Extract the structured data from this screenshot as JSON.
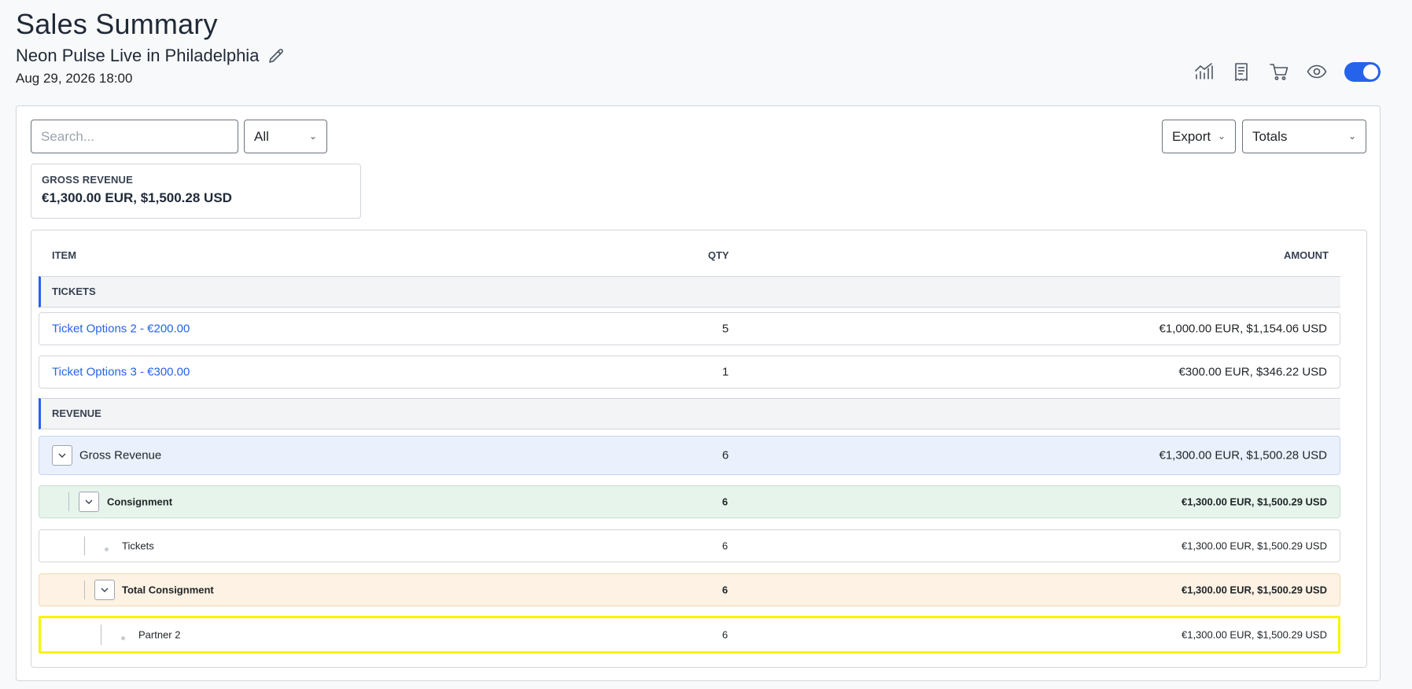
{
  "header": {
    "title": "Sales Summary",
    "event_name": "Neon Pulse Live in Philadelphia",
    "event_date": "Aug 29, 2026 18:00"
  },
  "toolbar": {
    "icons": [
      "analytics-chart-icon",
      "receipt-icon",
      "cart-icon",
      "eye-icon"
    ],
    "toggle_on": true,
    "accent": "#2563eb"
  },
  "filters": {
    "search_placeholder": "Search...",
    "filter_value": "All",
    "export_label": "Export",
    "totals_value": "Totals"
  },
  "gross_card": {
    "label": "GROSS REVENUE",
    "value": "€1,300.00 EUR, $1,500.28 USD"
  },
  "table": {
    "headers": {
      "item": "ITEM",
      "qty": "QTY",
      "amount": "AMOUNT"
    },
    "sections": {
      "tickets": "TICKETS",
      "revenue": "REVENUE"
    },
    "tickets": [
      {
        "name": "Ticket Options 2 - €200.00",
        "qty": "5",
        "amount": "€1,000.00 EUR, $1,154.06 USD"
      },
      {
        "name": "Ticket Options 3 - €300.00",
        "qty": "1",
        "amount": "€300.00 EUR, $346.22 USD"
      }
    ],
    "revenue": {
      "gross": {
        "name": "Gross Revenue",
        "qty": "6",
        "amount": "€1,300.00 EUR, $1,500.28 USD"
      },
      "consignment": {
        "name": "Consignment",
        "qty": "6",
        "amount": "€1,300.00 EUR, $1,500.29 USD"
      },
      "tickets": {
        "name": "Tickets",
        "qty": "6",
        "amount": "€1,300.00 EUR, $1,500.29 USD"
      },
      "total_consignment": {
        "name": "Total Consignment",
        "qty": "6",
        "amount": "€1,300.00 EUR, $1,500.29 USD"
      },
      "partner": {
        "name": "Partner 2",
        "qty": "6",
        "amount": "€1,300.00 EUR, $1,500.29 USD"
      }
    }
  }
}
